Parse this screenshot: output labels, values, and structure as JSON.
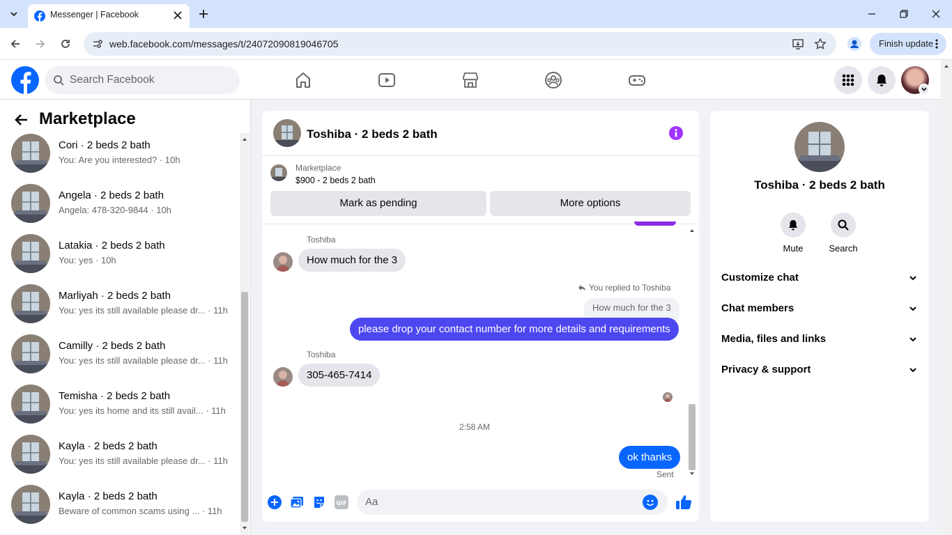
{
  "browser": {
    "tab_title": "Messenger | Facebook",
    "url": "web.facebook.com/messages/t/24072090819046705",
    "finish_update": "Finish update"
  },
  "fb": {
    "search_placeholder": "Search Facebook"
  },
  "sidebar": {
    "title": "Marketplace",
    "conversations": [
      {
        "name": "Cori · 2 beds 2 bath",
        "preview": "You: Are you interested? · 10h"
      },
      {
        "name": "Angela · 2 beds 2 bath",
        "preview": "Angela: 478-320-9844 · 10h"
      },
      {
        "name": "Latakia · 2 beds 2 bath",
        "preview": "You: yes · 10h"
      },
      {
        "name": "Marliyah · 2 beds 2 bath",
        "preview": "You: yes its still available please dr... · 11h"
      },
      {
        "name": "Camilly · 2 beds 2 bath",
        "preview": "You: yes its still available please dr... · 11h"
      },
      {
        "name": "Temisha · 2 beds 2 bath",
        "preview": "You: yes its home and its still avail... · 11h"
      },
      {
        "name": "Kayla · 2 beds 2 bath",
        "preview": "You: yes its still available please dr... · 11h"
      },
      {
        "name": "Kayla · 2 beds 2 bath",
        "preview": "Beware of common scams using ... · 11h"
      }
    ]
  },
  "chat": {
    "title": "Toshiba · 2 beds 2 bath",
    "listing_label": "Marketplace",
    "listing_price": "$900 - 2 beds 2 bath",
    "mark_pending": "Mark as pending",
    "more_options": "More options",
    "messages": {
      "sender1": "Toshiba",
      "msg1": "How much for the 3",
      "replied_to": "You replied to Toshiba",
      "quoted": "How much for the 3",
      "reply": "please drop your contact number for more details and requirements",
      "sender2": "Toshiba",
      "msg2": "305-465-7414",
      "timestamp": "2:58 AM",
      "msg3": "ok thanks",
      "status": "Sent"
    },
    "composer_placeholder": "Aa"
  },
  "details": {
    "name": "Toshiba · 2 beds 2 bath",
    "mute": "Mute",
    "search": "Search",
    "sections": [
      "Customize chat",
      "Chat members",
      "Media, files and links",
      "Privacy & support"
    ]
  },
  "colors": {
    "fb_blue": "#0866ff",
    "outgoing_bubble": "#4d47f0",
    "info_purple": "#a033ff"
  }
}
